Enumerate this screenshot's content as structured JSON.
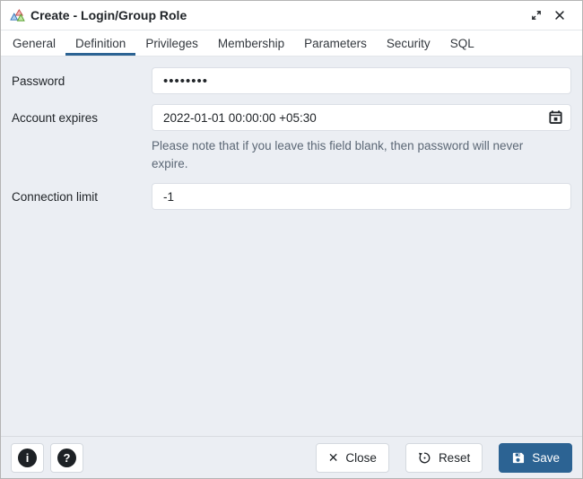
{
  "window": {
    "title": "Create - Login/Group Role"
  },
  "tabs": [
    "General",
    "Definition",
    "Privileges",
    "Membership",
    "Parameters",
    "Security",
    "SQL"
  ],
  "active_tab": "Definition",
  "form": {
    "password": {
      "label": "Password",
      "value": "••••••••"
    },
    "account_expires": {
      "label": "Account expires",
      "value": "2022-01-01 00:00:00 +05:30"
    },
    "note": "Please note that if you leave this field blank, then password will never expire.",
    "connection_limit": {
      "label": "Connection limit",
      "value": "-1"
    }
  },
  "footer": {
    "info_glyph": "i",
    "help_glyph": "?",
    "close_label": "Close",
    "close_glyph": "✕",
    "reset_label": "Reset",
    "save_label": "Save"
  },
  "colors": {
    "accent": "#2c6393",
    "content_bg": "#ebeef3"
  }
}
